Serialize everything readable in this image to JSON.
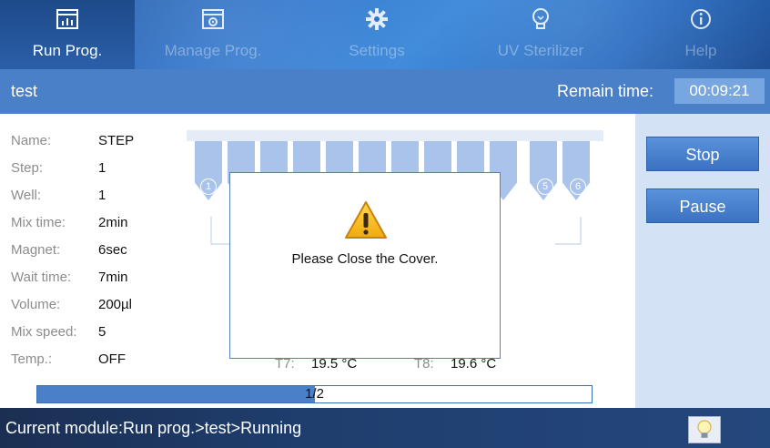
{
  "nav": {
    "tabs": [
      {
        "label": "Run Prog.",
        "icon": "chart-icon"
      },
      {
        "label": "Manage Prog.",
        "icon": "folder-gear-icon"
      },
      {
        "label": "Settings",
        "icon": "gear-icon"
      },
      {
        "label": "UV Sterilizer",
        "icon": "bulb-icon"
      },
      {
        "label": "Help",
        "icon": "info-icon"
      }
    ]
  },
  "header": {
    "program_name": "test",
    "remain_label": "Remain time:",
    "remain_value": "00:09:21"
  },
  "params": [
    {
      "label": "Name:",
      "value": "STEP"
    },
    {
      "label": "Step:",
      "value": "1"
    },
    {
      "label": "Well:",
      "value": "1"
    },
    {
      "label": "Mix time:",
      "value": "2min"
    },
    {
      "label": "Magnet:",
      "value": "6sec"
    },
    {
      "label": "Wait time:",
      "value": "7min"
    },
    {
      "label": "Volume:",
      "value": "200µl"
    },
    {
      "label": "Mix speed:",
      "value": "5"
    },
    {
      "label": "Temp.:",
      "value": "OFF"
    }
  ],
  "plate": {
    "wells_left": [
      "1"
    ],
    "wells_right": [
      "5",
      "6"
    ]
  },
  "temps": [
    {
      "label": "T7:",
      "value": "19.5 °C"
    },
    {
      "label": "T8:",
      "value": "19.6 °C"
    }
  ],
  "buttons": {
    "stop": "Stop",
    "pause": "Pause"
  },
  "dialog": {
    "message": "Please Close the Cover."
  },
  "progress": {
    "text": "1/2",
    "fraction": 0.5
  },
  "status": {
    "text": "Current module:Run prog.>test>Running"
  },
  "colors": {
    "accent": "#4a80c8",
    "nav": "#2f73c9",
    "side": "#d4e2f6"
  }
}
